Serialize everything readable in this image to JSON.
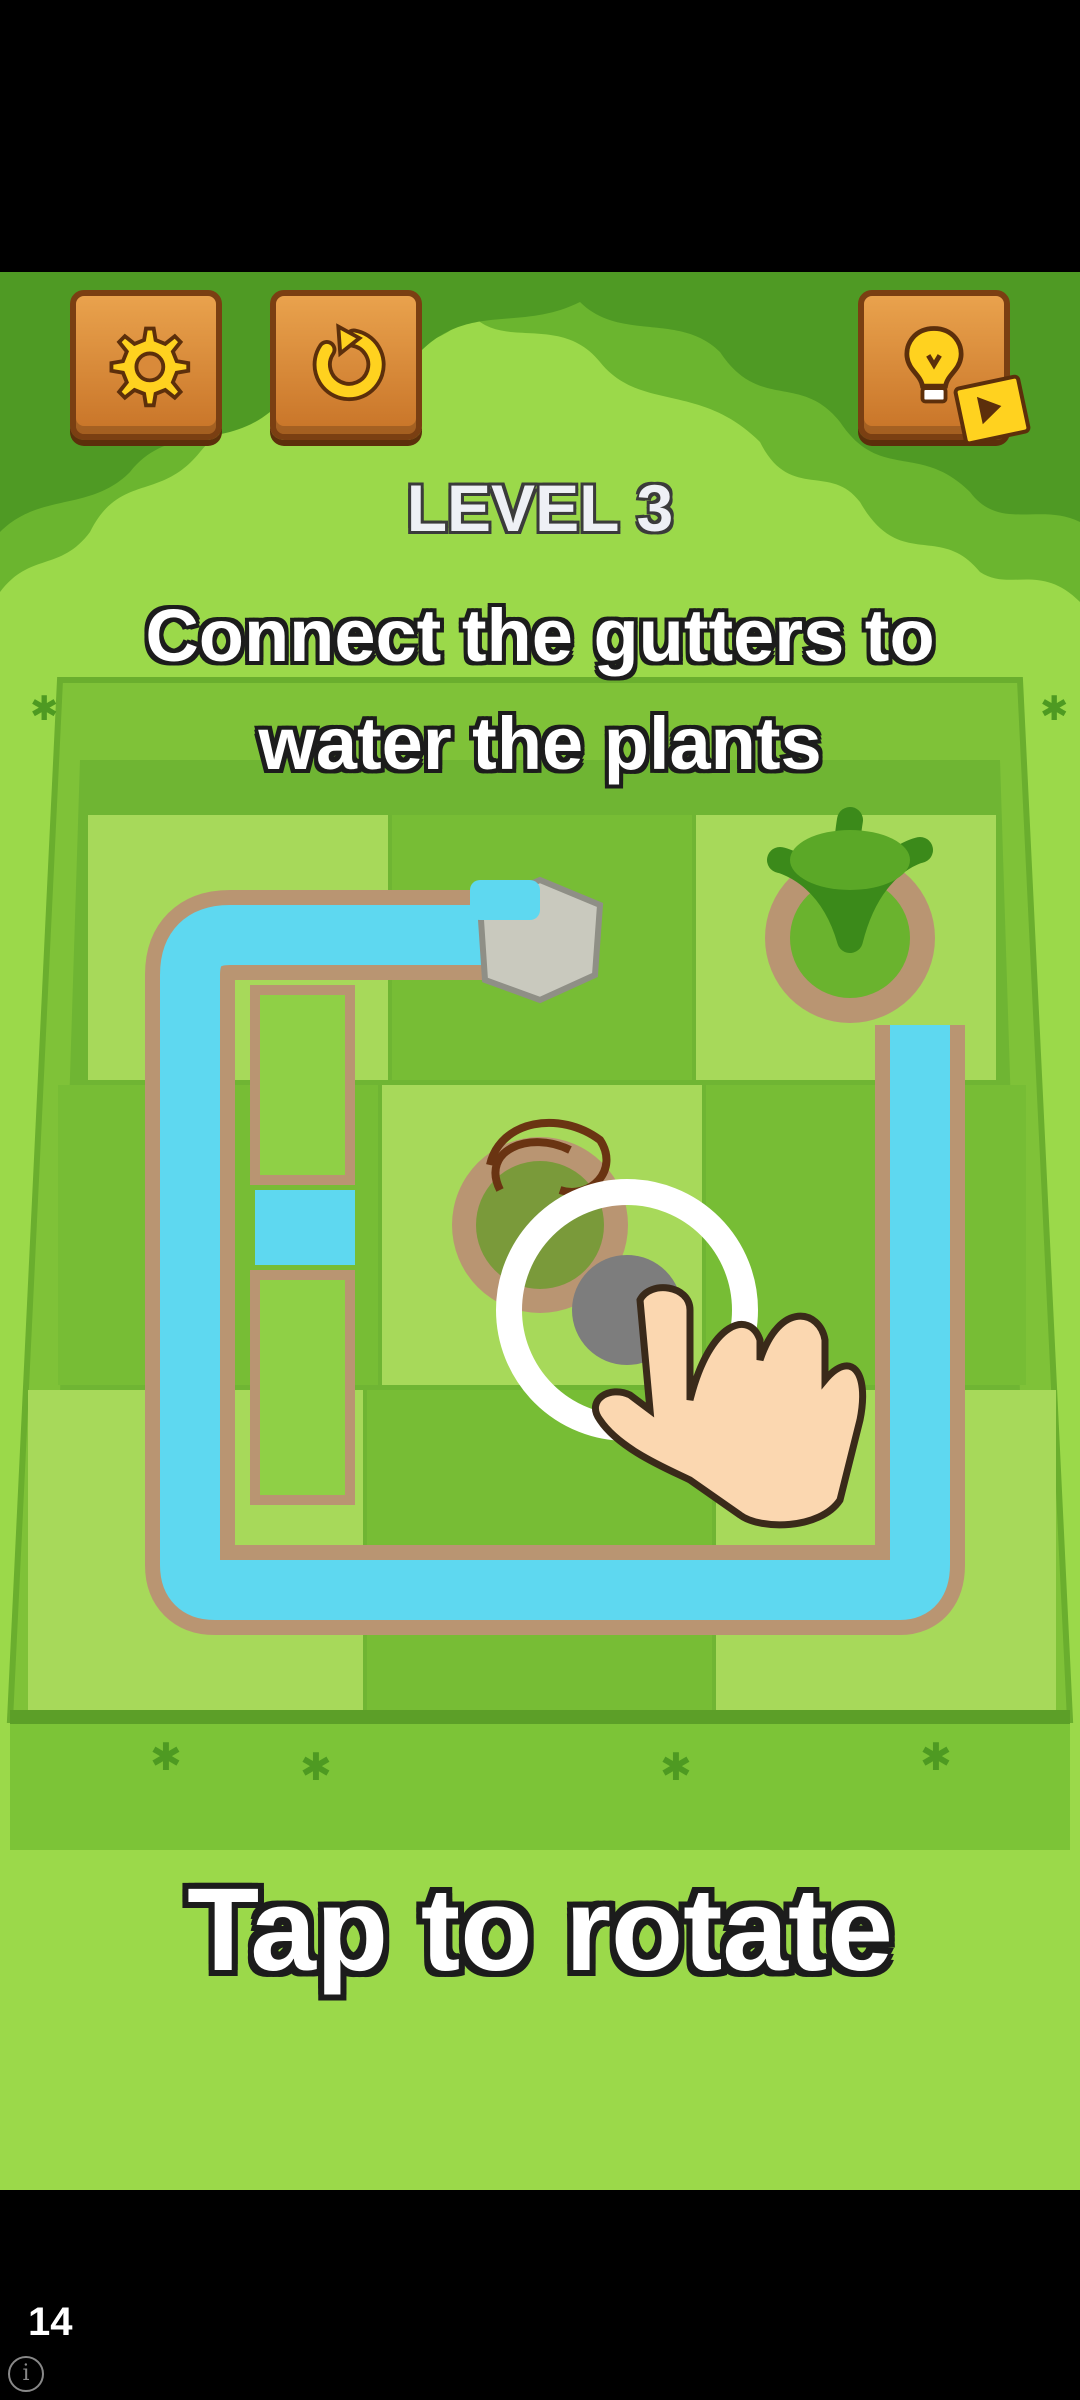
{
  "hud": {
    "settings": "gear-icon",
    "restart": "restart-icon",
    "hint": "lightbulb-icon",
    "hint_badge": "video-play-icon"
  },
  "level_label": "LEVEL 3",
  "instruction": [
    "Connect the gutters to",
    "water the plants"
  ],
  "tutorial_text": "Tap to rotate",
  "status_bar": {
    "number": "14",
    "info_icon": "info-icon"
  },
  "colors": {
    "grass": "#9bd94a",
    "tile_light": "#8fcb3e",
    "tile_dark": "#5fa32a",
    "water": "#5ed8f0",
    "brick": "#b99572",
    "wood": "#d98a3a"
  }
}
